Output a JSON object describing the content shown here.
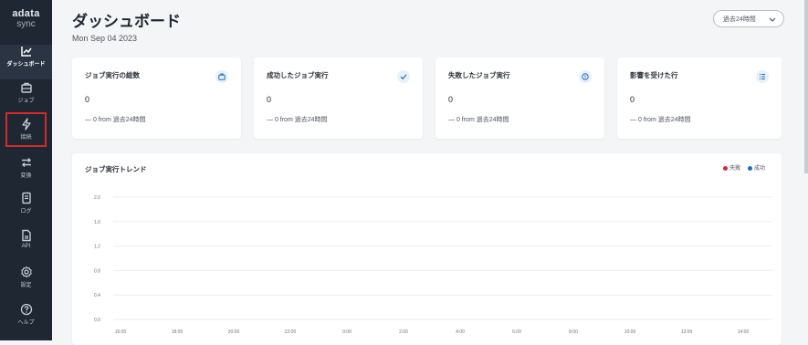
{
  "sidebar": {
    "logo_top": "adata",
    "logo_bottom": "sync",
    "items": [
      {
        "label": "ダッシュボード",
        "icon": "chart-icon"
      },
      {
        "label": "ジョブ",
        "icon": "briefcase-icon"
      },
      {
        "label": "接続",
        "icon": "lightning-icon"
      },
      {
        "label": "変換",
        "icon": "transfer-icon"
      },
      {
        "label": "ログ",
        "icon": "log-icon"
      },
      {
        "label": "API",
        "icon": "api-icon"
      },
      {
        "label": "設定",
        "icon": "gear-icon"
      },
      {
        "label": "ヘルプ",
        "icon": "help-icon"
      }
    ]
  },
  "header": {
    "title": "ダッシュボード",
    "date": "Mon Sep 04 2023",
    "range_label": "過去24時間"
  },
  "cards": [
    {
      "title": "ジョブ実行の総数",
      "value": "0",
      "sub": "— 0 from 過去24時間",
      "icon": "briefcase-icon"
    },
    {
      "title": "成功したジョブ実行",
      "value": "0",
      "sub": "— 0 from 過去24時間",
      "icon": "check-icon"
    },
    {
      "title": "失敗したジョブ実行",
      "value": "0",
      "sub": "— 0 from 過去24時間",
      "icon": "alert-icon"
    },
    {
      "title": "影響を受けた行",
      "value": "0",
      "sub": "— 0 from 過去24時間",
      "icon": "rows-icon"
    }
  ],
  "colors": {
    "sidebar_bg": "#1f2733",
    "failed": "#d7263d",
    "success": "#1f6fbf"
  },
  "chart_data": {
    "type": "line",
    "title": "ジョブ実行トレンド",
    "series": [
      {
        "name": "失敗",
        "values": [
          0,
          0,
          0,
          0,
          0,
          0,
          0,
          0,
          0,
          0,
          0,
          0
        ]
      },
      {
        "name": "成功",
        "values": [
          0,
          0,
          0,
          0,
          0,
          0,
          0,
          0,
          0,
          0,
          0,
          0
        ]
      }
    ],
    "categories": [
      "16:00",
      "18:00",
      "20:00",
      "22:00",
      "0:00",
      "2:00",
      "4:00",
      "6:00",
      "8:00",
      "10:00",
      "12:00",
      "14:00"
    ],
    "yticks": [
      "2.0",
      "1.6",
      "1.2",
      "0.8",
      "0.4",
      "0.0"
    ],
    "ylim": [
      0,
      2.0
    ],
    "grid": true,
    "legend": "top-right"
  }
}
